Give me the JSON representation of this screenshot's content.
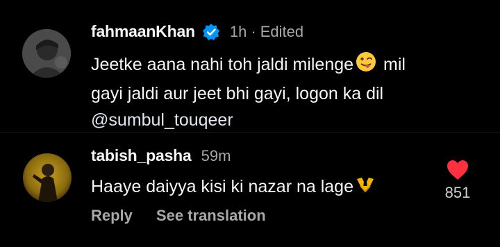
{
  "comments": [
    {
      "username": "fahmaanKhan",
      "time": "1h",
      "separator": "·",
      "edited": "Edited",
      "verified": true,
      "text_line1_a": "Jeetke aana nahi toh jaldi milenge",
      "text_line1_emoji": "winking-tongue-face",
      "text_line1_b": " mil",
      "text_line2": "gayi jaldi aur jeet bhi gayi, logon ka dil",
      "mention": "@sumbul_touqeer"
    },
    {
      "username": "tabish_pasha",
      "time": "59m",
      "text_a": "Haaye daiyya kisi ki nazar na lage",
      "text_emoji": "raised-hands",
      "reply_label": "Reply",
      "see_translation_label": "See translation",
      "like_count": "851",
      "like_color": "#ff3040"
    }
  ],
  "colors": {
    "background": "#000000",
    "primary_text": "#f5f5f5",
    "secondary_text": "#a8a8a8",
    "verified_blue": "#0095f6"
  }
}
